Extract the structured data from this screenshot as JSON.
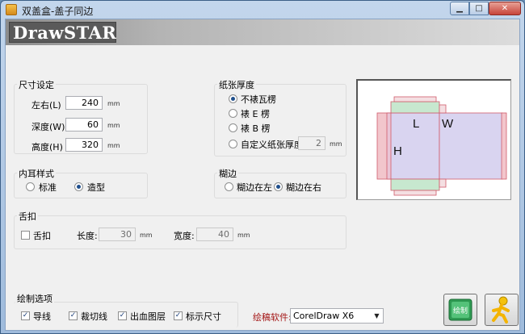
{
  "window": {
    "title": "双盖盒-盖子同边",
    "min": "▁",
    "max": "□",
    "close": "✕"
  },
  "banner": {
    "logo": "DrawSTAR"
  },
  "size": {
    "title": "尺寸设定",
    "rows": [
      {
        "label": "左右(L)",
        "value": "240",
        "unit": "mm"
      },
      {
        "label": "深度(W)",
        "value": "60",
        "unit": "mm"
      },
      {
        "label": "高度(H)",
        "value": "320",
        "unit": "mm"
      }
    ]
  },
  "paper": {
    "title": "纸张厚度",
    "options": [
      "不裱瓦楞",
      "裱 E 楞",
      "裱 B 楞",
      "自定义纸张厚度"
    ],
    "selected": 0,
    "custom_value": "2",
    "custom_unit": "mm"
  },
  "inner_ear": {
    "title": "内耳样式",
    "options": [
      "标准",
      "造型"
    ],
    "selected": 1
  },
  "glue": {
    "title": "糊边",
    "options": [
      "糊边在左",
      "糊边在右"
    ],
    "selected": 1
  },
  "tongue": {
    "title": "舌扣",
    "checkbox_label": "舌扣",
    "checked": false,
    "length_label": "长度:",
    "length_value": "30",
    "length_unit": "mm",
    "width_label": "宽度:",
    "width_value": "40",
    "width_unit": "mm"
  },
  "draw_options": {
    "title": "绘制选项",
    "items": [
      {
        "label": "导线",
        "checked": true
      },
      {
        "label": "裁切线",
        "checked": true
      },
      {
        "label": "出血图层",
        "checked": true
      },
      {
        "label": "标示尺寸",
        "checked": true
      }
    ]
  },
  "software": {
    "label": "绘稿软件:",
    "value": "CorelDraw X6"
  },
  "preview": {
    "labels": {
      "l": "L",
      "w": "W",
      "h": "H"
    }
  },
  "buttons": {
    "draw_label": "绘制",
    "draw_icon": "draw-icon",
    "run_icon": "running-man-icon"
  },
  "colors": {
    "panel_pink": "#f2c6cc",
    "panel_purple": "#d9d4f0",
    "panel_green": "#c7e8cf",
    "label_red": "#a31515"
  }
}
